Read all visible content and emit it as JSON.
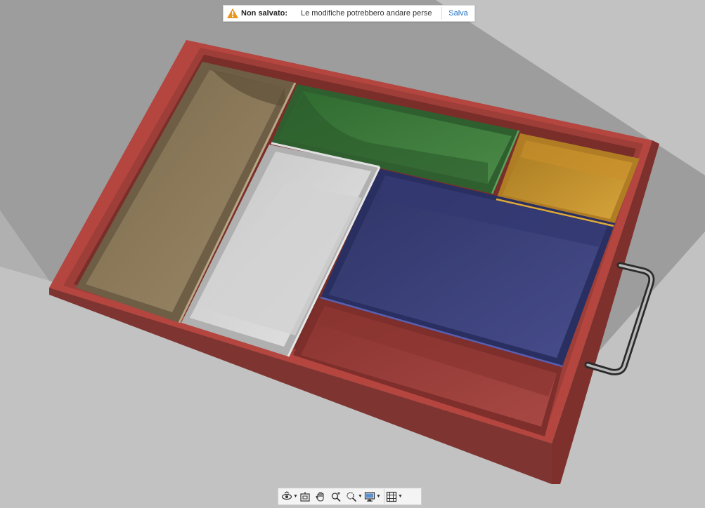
{
  "notification": {
    "title": "Non salvato:",
    "message": "Le modifiche potrebbero andare perse",
    "save_label": "Salva",
    "icon": "warning-icon",
    "icon_color": "#e8951a",
    "link_color": "#1a6fc2"
  },
  "model": {
    "outer_color": "#b04640",
    "compartment_colors": {
      "tan": "#8b7a5e",
      "green": "#3c7a3c",
      "white": "#dcdcdc",
      "yellow": "#c8962e",
      "blue": "#3a3f78",
      "red": "#9a3c38"
    },
    "handle_color": "#555555"
  },
  "navbar": {
    "items": [
      {
        "icon": "orbit-icon",
        "dropdown": true
      },
      {
        "icon": "look-at-icon",
        "dropdown": false
      },
      {
        "icon": "pan-hand-icon",
        "dropdown": false
      },
      {
        "icon": "zoom-icon",
        "dropdown": false
      },
      {
        "icon": "fit-zoom-icon",
        "dropdown": true
      },
      {
        "icon": "display-settings-icon",
        "dropdown": true
      },
      {
        "icon": "grid-icon",
        "dropdown": true
      }
    ]
  }
}
